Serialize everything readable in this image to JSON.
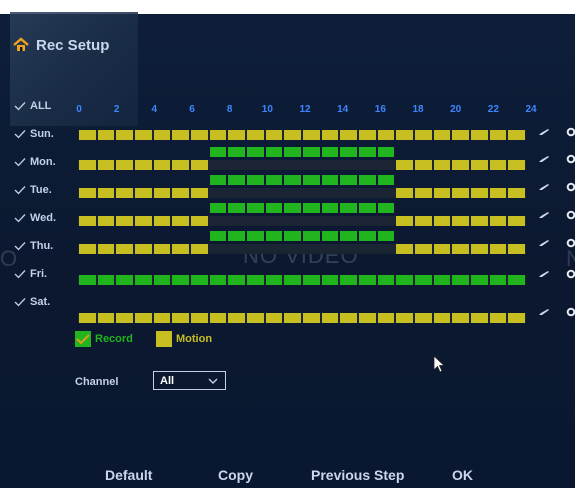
{
  "title": "Rec Setup",
  "hours": [
    "0",
    "2",
    "4",
    "6",
    "8",
    "10",
    "12",
    "14",
    "16",
    "18",
    "20",
    "22",
    "24"
  ],
  "days": [
    {
      "label": "ALL",
      "checked": true
    },
    {
      "label": "Sun.",
      "checked": true
    },
    {
      "label": "Mon.",
      "checked": true
    },
    {
      "label": "Tue.",
      "checked": true
    },
    {
      "label": "Wed.",
      "checked": true
    },
    {
      "label": "Thu.",
      "checked": true
    },
    {
      "label": "Fri.",
      "checked": true
    },
    {
      "label": "Sat.",
      "checked": true
    }
  ],
  "schedule": [
    {
      "day": "Sun.",
      "segments": [
        {
          "start": 0,
          "end": 24,
          "mode": "motion"
        }
      ]
    },
    {
      "day": "Mon.",
      "segments": [
        {
          "start": 0,
          "end": 7,
          "mode": "motion"
        },
        {
          "start": 7,
          "end": 17,
          "mode": "record"
        },
        {
          "start": 17,
          "end": 24,
          "mode": "motion"
        }
      ]
    },
    {
      "day": "Tue.",
      "segments": [
        {
          "start": 0,
          "end": 7,
          "mode": "motion"
        },
        {
          "start": 7,
          "end": 17,
          "mode": "record"
        },
        {
          "start": 17,
          "end": 24,
          "mode": "motion"
        }
      ]
    },
    {
      "day": "Wed.",
      "segments": [
        {
          "start": 0,
          "end": 7,
          "mode": "motion"
        },
        {
          "start": 7,
          "end": 17,
          "mode": "record"
        },
        {
          "start": 17,
          "end": 24,
          "mode": "motion"
        }
      ]
    },
    {
      "day": "Thu.",
      "segments": [
        {
          "start": 0,
          "end": 7,
          "mode": "motion"
        },
        {
          "start": 7,
          "end": 17,
          "mode": "record"
        },
        {
          "start": 17,
          "end": 24,
          "mode": "motion"
        }
      ]
    },
    {
      "day": "Fri.",
      "segments": [
        {
          "start": 0,
          "end": 24,
          "mode": "record"
        }
      ]
    },
    {
      "day": "Sat.",
      "segments": [
        {
          "start": 0,
          "end": 24,
          "mode": "motion"
        }
      ]
    }
  ],
  "legend": {
    "record": {
      "label": "Record",
      "color": "#22b41e"
    },
    "motion": {
      "label": "Motion",
      "color": "#c7be22"
    }
  },
  "channel": {
    "label": "Channel",
    "value": "All"
  },
  "buttons": {
    "default": "Default",
    "copy": "Copy",
    "previous": "Previous Step",
    "ok": "OK"
  },
  "overlay": {
    "no_video": "NO VIDEO"
  },
  "colors": {
    "accent": "#3e86ff",
    "record": "#22b41e",
    "motion": "#c7be22",
    "background": "#0c1a33"
  }
}
